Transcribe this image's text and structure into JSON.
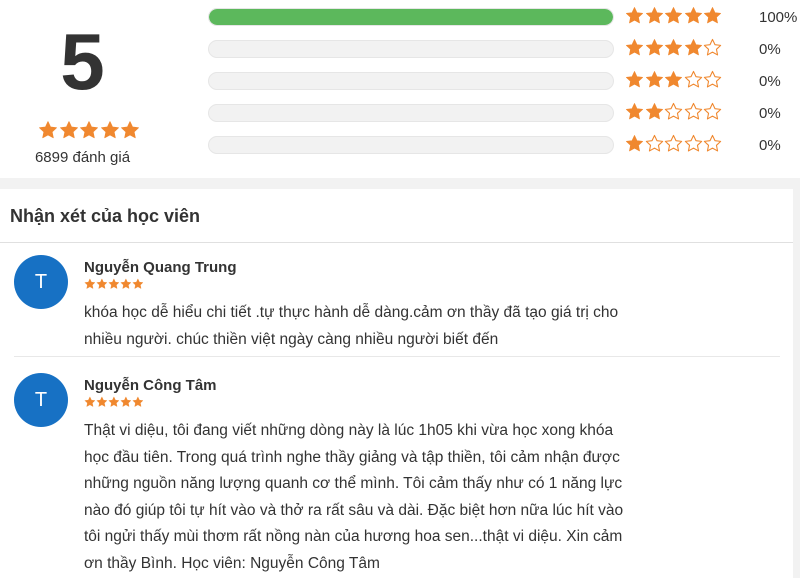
{
  "summary": {
    "average": "5",
    "average_stars": 5,
    "count_text": "6899 đánh giá",
    "star_color": "#f0882f",
    "bar_color": "#5cb85c"
  },
  "distribution": [
    {
      "stars": 5,
      "fraction": 1.0,
      "percent": "100%"
    },
    {
      "stars": 4,
      "fraction": 0.0,
      "percent": "0%"
    },
    {
      "stars": 3,
      "fraction": 0.0,
      "percent": "0%"
    },
    {
      "stars": 2,
      "fraction": 0.0,
      "percent": "0%"
    },
    {
      "stars": 1,
      "fraction": 0.0,
      "percent": "0%"
    }
  ],
  "reviews_section": {
    "heading": "Nhận xét của học viên",
    "items": [
      {
        "avatar_letter": "T",
        "avatar_color": "#1771c4",
        "name": "Nguyễn Quang Trung",
        "rating": 5,
        "lines": [
          "khóa học dễ hiểu chi tiết .tự thực hành dễ dàng.cảm ơn thầy đã tạo giá trị cho",
          "nhiều người. chúc thiền việt ngày càng nhiều người biết đến"
        ]
      },
      {
        "avatar_letter": "T",
        "avatar_color": "#1771c4",
        "name": "Nguyễn Công Tâm",
        "rating": 5,
        "lines": [
          "Thật vi diệu, tôi đang viết những dòng này là lúc 1h05 khi vừa học xong khóa",
          "học đầu tiên. Trong quá trình nghe thầy giảng và tập thiền, tôi cảm nhận được",
          "những nguồn năng lượng quanh cơ thể mình. Tôi cảm thấy như có 1 năng lực",
          "nào đó giúp tôi tự hít vào và thở ra rất sâu và dài. Đặc biệt hơn nữa lúc hít vào",
          "tôi ngửi thấy mùi thơm rất nồng nàn của hương hoa sen...thật vi diệu. Xin cảm",
          "ơn thầy Bình. Học viên: Nguyễn Công Tâm"
        ]
      }
    ]
  }
}
